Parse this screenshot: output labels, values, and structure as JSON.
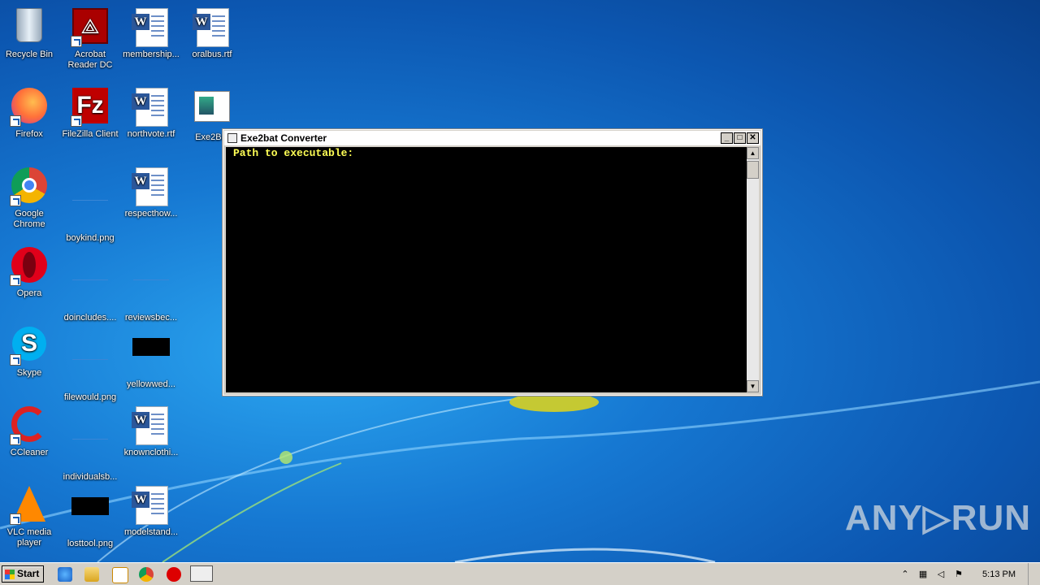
{
  "desktop": {
    "icons": [
      {
        "label": "Recycle Bin",
        "kind": "recycle"
      },
      {
        "label": "Acrobat Reader DC",
        "kind": "acrobat"
      },
      {
        "label": "membership...",
        "kind": "word"
      },
      {
        "label": "oralbus.rtf",
        "kind": "word"
      },
      {
        "label": "Firefox",
        "kind": "firefox"
      },
      {
        "label": "FileZilla Client",
        "kind": "filezilla"
      },
      {
        "label": "northvote.rtf",
        "kind": "word"
      },
      {
        "label": "Exe2Bat",
        "kind": "app"
      },
      {
        "label": "Google Chrome",
        "kind": "chrome"
      },
      {
        "label": "boykind.png",
        "kind": "png"
      },
      {
        "label": "respecthow...",
        "kind": "word"
      },
      {
        "label": "Opera",
        "kind": "opera"
      },
      {
        "label": "doincludes....",
        "kind": "png"
      },
      {
        "label": "reviewsbec...",
        "kind": "png"
      },
      {
        "label": "Skype",
        "kind": "skype"
      },
      {
        "label": "filewould.png",
        "kind": "png"
      },
      {
        "label": "yellowwed...",
        "kind": "black"
      },
      {
        "label": "CCleaner",
        "kind": "ccleaner"
      },
      {
        "label": "individualsb...",
        "kind": "png"
      },
      {
        "label": "knownclothi...",
        "kind": "word"
      },
      {
        "label": "VLC media player",
        "kind": "vlc"
      },
      {
        "label": "losttool.png",
        "kind": "black"
      },
      {
        "label": "modelstand...",
        "kind": "word"
      }
    ]
  },
  "window": {
    "title": "Exe2bat Converter",
    "console_text": "Path to executable:",
    "buttons": {
      "minimize": "_",
      "maximize": "□",
      "close": "✕"
    }
  },
  "taskbar": {
    "start_label": "Start",
    "clock": "5:13 PM",
    "tray_up": "⌃"
  },
  "watermark": "ANY▷RUN"
}
